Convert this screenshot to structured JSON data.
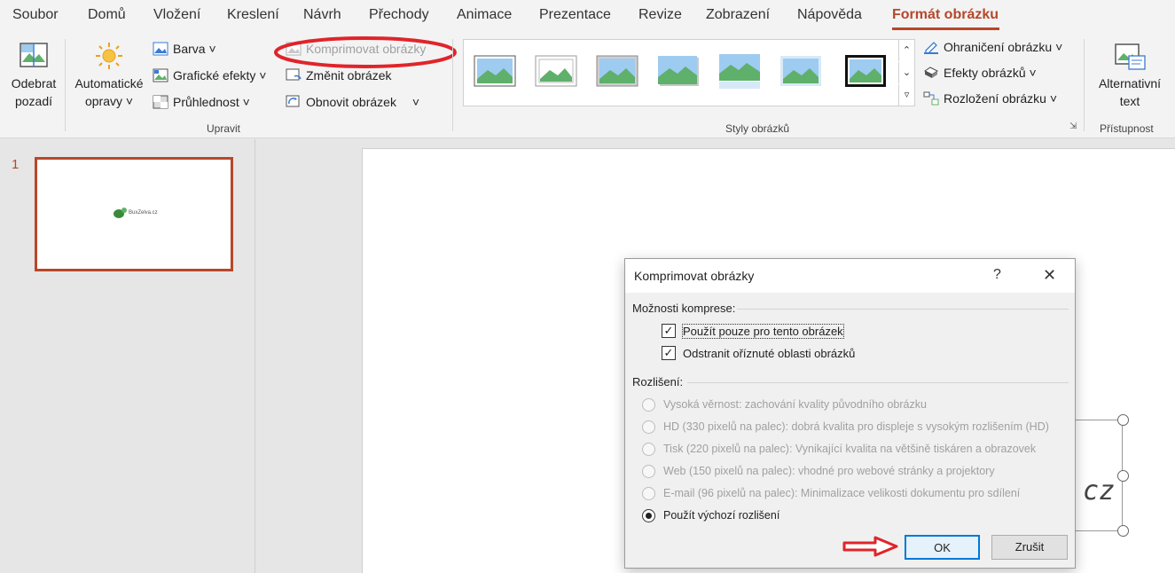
{
  "tabs": [
    "Soubor",
    "Domů",
    "Vložení",
    "Kreslení",
    "Návrh",
    "Přechody",
    "Animace",
    "Prezentace",
    "Revize",
    "Zobrazení",
    "Nápověda",
    "Formát obrázku"
  ],
  "ribbon": {
    "remove_bg": [
      "Odebrat",
      "pozadí"
    ],
    "auto_fix": [
      "Automatické",
      "opravy ˅"
    ],
    "color": "Barva ˅",
    "artistic": "Grafické efekty ˅",
    "transparency": "Průhlednost ˅",
    "compress": "Komprimovat obrázky",
    "change": "Změnit obrázek",
    "reset": "Obnovit obrázek",
    "reset_caret": "˅",
    "group_adjust": "Upravit",
    "group_styles": "Styly obrázků",
    "border": "Ohraničení obrázku ˅",
    "effects": "Efekty obrázků ˅",
    "layout": "Rozložení obrázku ˅",
    "alt_text": [
      "Alternativní",
      "text"
    ],
    "group_access": "Přístupnost"
  },
  "slides": {
    "number": "1",
    "thumb_logo_text": "BuxZelva.cz"
  },
  "canvas": {
    "visible_text": ".cz"
  },
  "dialog": {
    "title": "Komprimovat obrázky",
    "help": "?",
    "close": "✕",
    "compress_options_label": "Možnosti komprese:",
    "apply_only_this": "Použít pouze pro tento obrázek",
    "delete_cropped": "Odstranit oříznuté oblasti obrázků",
    "resolution_label": "Rozlišení:",
    "options": [
      "Vysoká věrnost: zachování kvality původního obrázku",
      "HD (330 pixelů na palec): dobrá kvalita pro displeje s vysokým rozlišením (HD)",
      "Tisk (220 pixelů na palec): Vynikající kvalita na většině tiskáren a obrazovek",
      "Web (150 pixelů na palec): vhodné pro webové stránky a projektory",
      "E-mail (96 pixelů na palec): Minimalizace velikosti dokumentu pro sdílení",
      "Použít výchozí rozlišení"
    ],
    "selected_option_index": 5,
    "ok": "OK",
    "cancel": "Zrušit"
  },
  "colors": {
    "accent": "#b7472a",
    "highlight_ellipse": "#e0242a",
    "arrow": "#e0242a",
    "ok_border": "#0078d7"
  }
}
